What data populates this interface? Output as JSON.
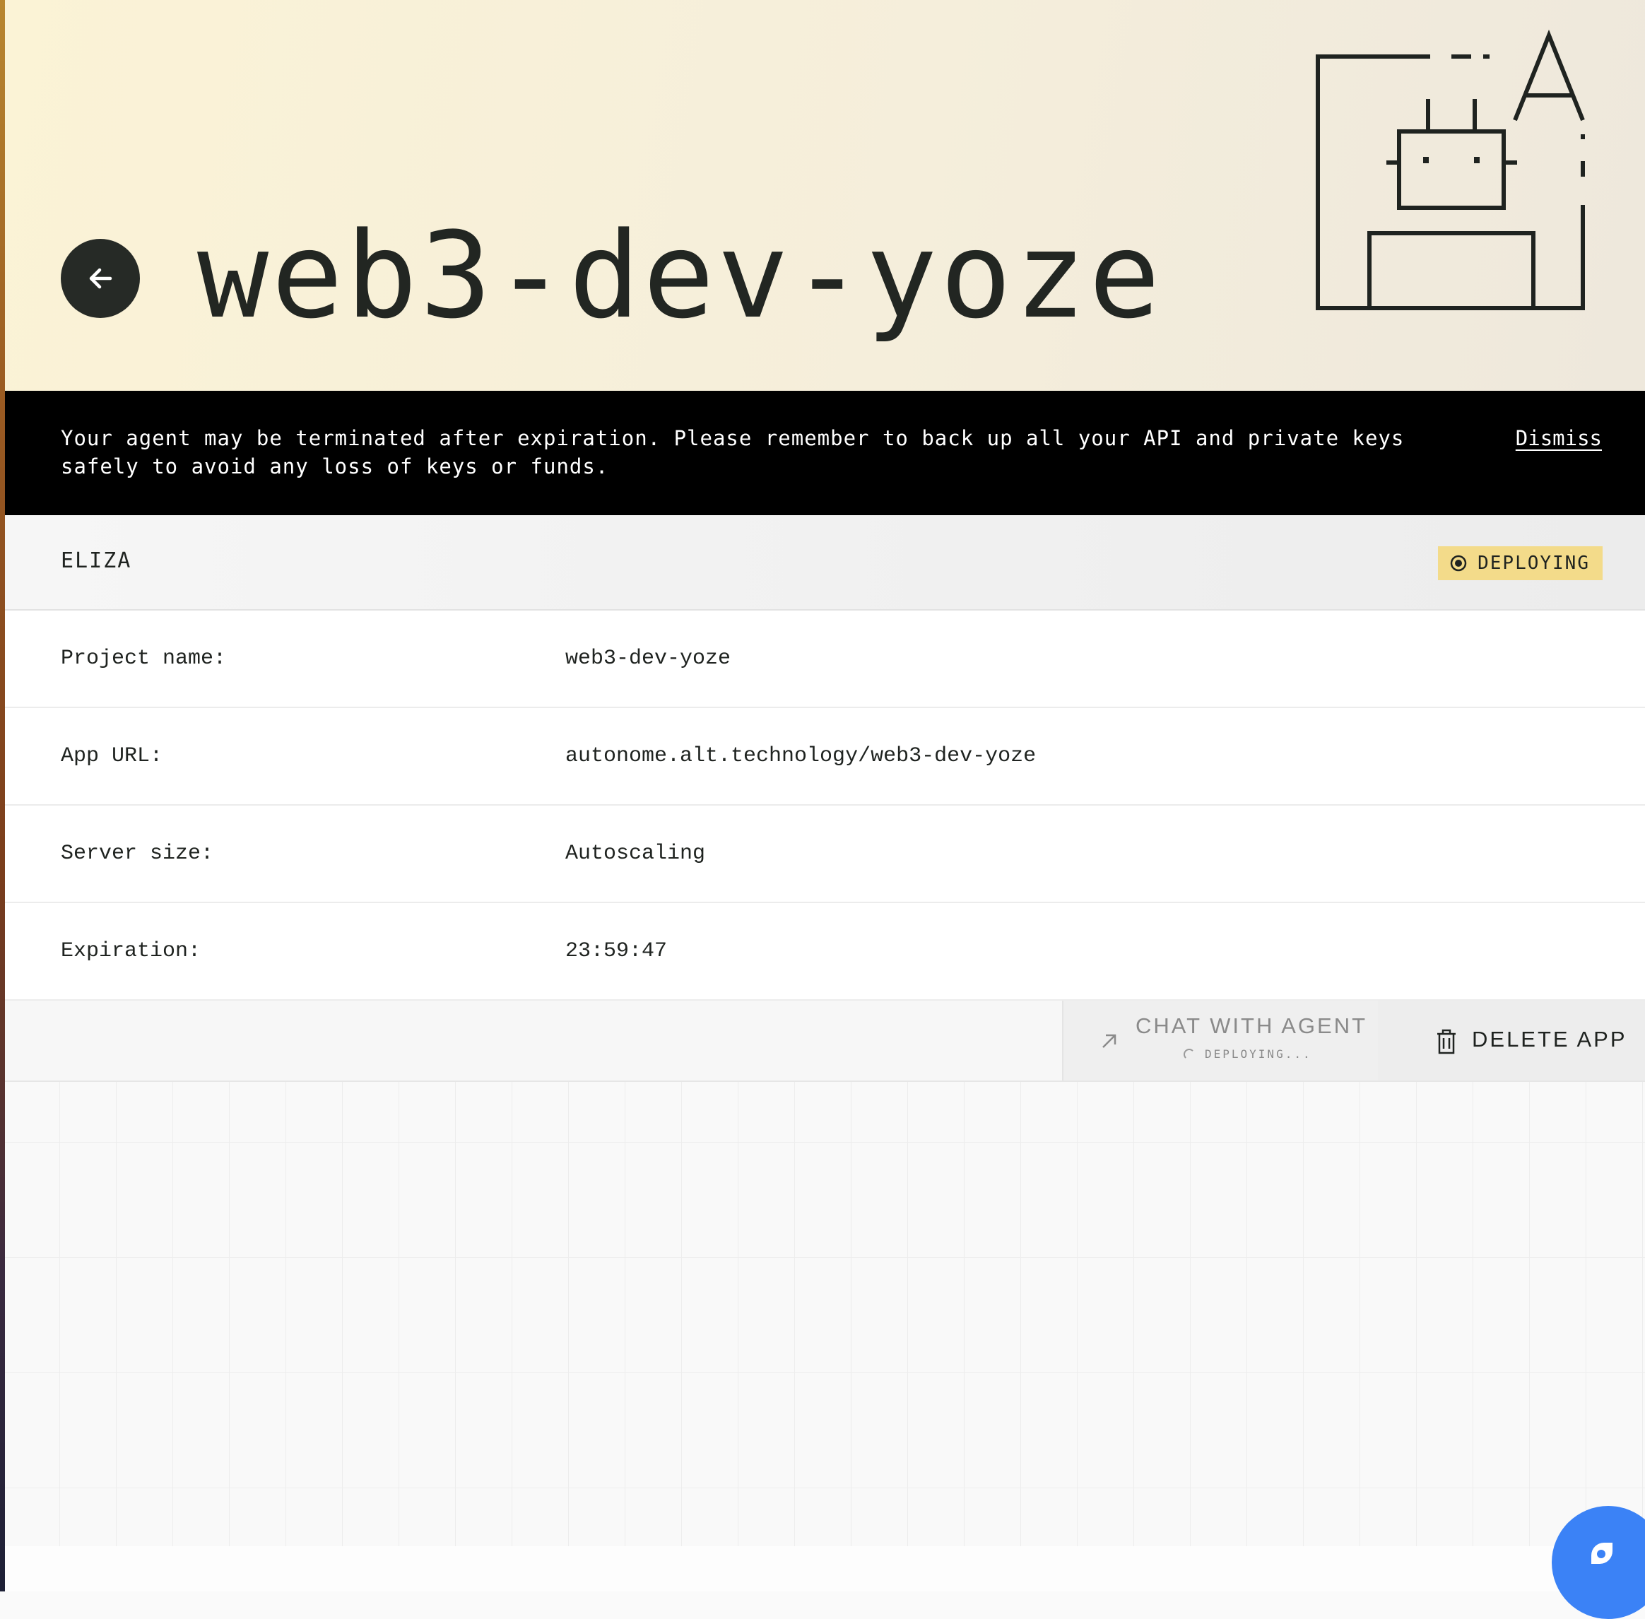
{
  "header": {
    "title": "web3-dev-yoze",
    "back_icon": "arrow-left-icon",
    "logo_icon": "robot-agent-illustration"
  },
  "banner": {
    "message": "Your agent may be terminated after expiration. Please remember to back up all your API and private keys safely to avoid any loss of keys or funds.",
    "dismiss_label": "Dismiss"
  },
  "section": {
    "title": "ELIZA",
    "status": {
      "label": "DEPLOYING",
      "icon": "radio-dot-icon",
      "color": "#f3db8a"
    }
  },
  "details": [
    {
      "label": "Project name:",
      "value": "web3-dev-yoze"
    },
    {
      "label": "App URL:",
      "value": "autonome.alt.technology/web3-dev-yoze"
    },
    {
      "label": "Server size:",
      "value": "Autoscaling"
    },
    {
      "label": "Expiration:",
      "value": "23:59:47"
    }
  ],
  "actions": {
    "chat": {
      "label": "CHAT WITH AGENT",
      "sub_label": "DEPLOYING...",
      "icon": "arrow-up-right-icon"
    },
    "delete": {
      "label": "DELETE APP",
      "icon": "trash-icon"
    }
  },
  "support": {
    "icon": "chat-bubble-icon",
    "color": "#3b82f6"
  }
}
